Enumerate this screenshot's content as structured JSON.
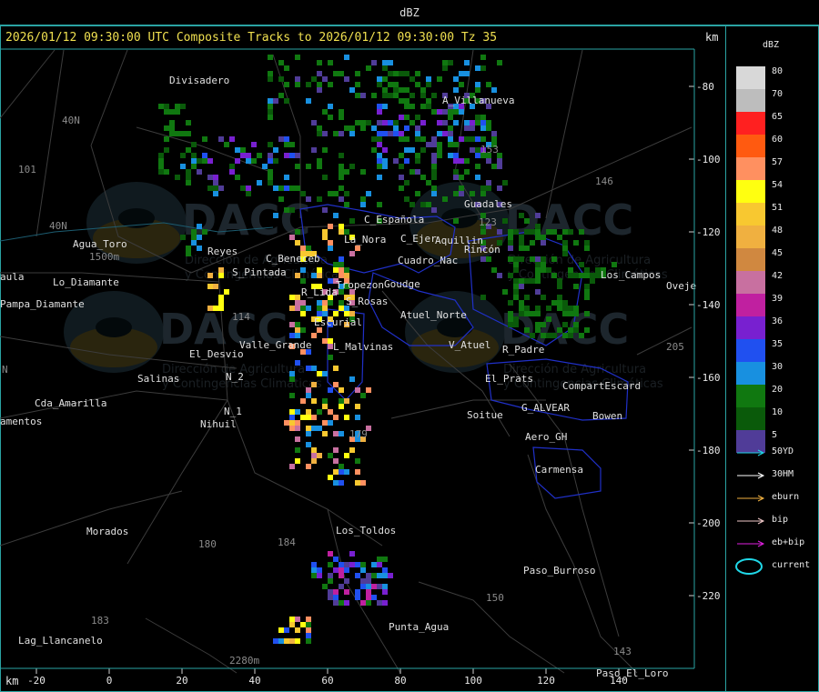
{
  "header": {
    "title": "dBZ"
  },
  "map": {
    "subtitle": "2026/01/12 09:30:00 UTC Composite Tracks to 2026/01/12 09:30:00 Tz 35",
    "unit_label": "km",
    "x_ticks": [
      "-20",
      "0",
      "20",
      "40",
      "60",
      "80",
      "100",
      "120",
      "140"
    ],
    "y_ticks": [
      "-80",
      "-100",
      "-120",
      "-140",
      "-160",
      "-180",
      "-200",
      "-220"
    ],
    "places": [
      {
        "name": "Divisadero"
      },
      {
        "name": "A_Villanueva"
      },
      {
        "name": "40N"
      },
      {
        "name": "101"
      },
      {
        "name": "40N"
      },
      {
        "name": "Agua_Toro"
      },
      {
        "name": "1500m"
      },
      {
        "name": "aula"
      },
      {
        "name": "Lo_Diamante"
      },
      {
        "name": "Pampa_Diamante"
      },
      {
        "name": "Reyes"
      },
      {
        "name": "S_Pintada"
      },
      {
        "name": "C_Beneceb"
      },
      {
        "name": "La_Nora"
      },
      {
        "name": "C_Española"
      },
      {
        "name": "C_Ejer"
      },
      {
        "name": "Cuadro_Nac"
      },
      {
        "name": "Aquillin"
      },
      {
        "name": "Rincón"
      },
      {
        "name": "Guadales"
      },
      {
        "name": "Tropezon"
      },
      {
        "name": "Goudge"
      },
      {
        "name": "R_Lida"
      },
      {
        "name": "S_Rosas"
      },
      {
        "name": "Atuel_Norte"
      },
      {
        "name": "Escurial"
      },
      {
        "name": "Valle_Grande"
      },
      {
        "name": "L_Malvinas"
      },
      {
        "name": "El_Desvio"
      },
      {
        "name": "V_Atuel"
      },
      {
        "name": "R_Padre"
      },
      {
        "name": "Salinas"
      },
      {
        "name": "N_2"
      },
      {
        "name": "El_Prats"
      },
      {
        "name": "CompartEscard"
      },
      {
        "name": "N_1"
      },
      {
        "name": "Cda_Amarilla"
      },
      {
        "name": "amentos"
      },
      {
        "name": "Nihuil"
      },
      {
        "name": "G_ALVEAR"
      },
      {
        "name": "Soitue"
      },
      {
        "name": "Bowen"
      },
      {
        "name": "Aero_GH"
      },
      {
        "name": "Carmensa"
      },
      {
        "name": "Morados"
      },
      {
        "name": "Los_Toldos"
      },
      {
        "name": "Paso_Burroso"
      },
      {
        "name": "Punta_Agua"
      },
      {
        "name": "Lag_Llancanelo"
      },
      {
        "name": "Paso_El_Loro"
      },
      {
        "name": "Los_Campos"
      },
      {
        "name": "Oveje"
      },
      {
        "name": "2280m"
      },
      {
        "name": "N"
      },
      {
        "name": "205"
      },
      {
        "name": "146"
      },
      {
        "name": "153"
      },
      {
        "name": "143"
      },
      {
        "name": "150"
      },
      {
        "name": "180"
      },
      {
        "name": "184"
      },
      {
        "name": "183"
      },
      {
        "name": "179"
      },
      {
        "name": "114"
      },
      {
        "name": "123"
      }
    ],
    "watermarks": [
      {
        "text": "DACC",
        "sub1": "Dirección de Agricultura",
        "sub2": "y Contingencias Climáticas"
      },
      {
        "text": "DACC",
        "sub1": "Dirección de Agricultura",
        "sub2": "y Contingencias Climáticas"
      },
      {
        "text": "DACC",
        "sub1": "Dirección de Agricultura",
        "sub2": "y Contingencias Climáticas"
      },
      {
        "text": "DACC",
        "sub1": "Dirección de Agricultura",
        "sub2": "y Contingencias Climáticas"
      }
    ]
  },
  "legend": {
    "title": "dBZ",
    "scale": [
      {
        "value": "80",
        "color": "#d8d8d8"
      },
      {
        "value": "70",
        "color": "#bdbdbd"
      },
      {
        "value": "65",
        "color": "#ff2020"
      },
      {
        "value": "60",
        "color": "#ff5a10"
      },
      {
        "value": "57",
        "color": "#ff9060"
      },
      {
        "value": "54",
        "color": "#ffff10"
      },
      {
        "value": "51",
        "color": "#f8c830"
      },
      {
        "value": "48",
        "color": "#f0b040"
      },
      {
        "value": "45",
        "color": "#d08840"
      },
      {
        "value": "42",
        "color": "#c870a0"
      },
      {
        "value": "39",
        "color": "#c020a0"
      },
      {
        "value": "36",
        "color": "#7820d0"
      },
      {
        "value": "35",
        "color": "#2050f0"
      },
      {
        "value": "30",
        "color": "#1890e0"
      },
      {
        "value": "20",
        "color": "#107810"
      },
      {
        "value": "10",
        "color": "#0a5a0a"
      },
      {
        "value": "5",
        "color": "#503c98"
      }
    ],
    "tracks": [
      {
        "label": "50YD",
        "color": "#20d8e8"
      },
      {
        "label": "30HM",
        "color": "#ffffff"
      },
      {
        "label": "eburn",
        "color": "#f0b040"
      },
      {
        "label": "bip",
        "color": "#f0c8c8"
      },
      {
        "label": "eb+bip",
        "color": "#e020e0"
      },
      {
        "label": "current",
        "color": "#20d8e8"
      }
    ]
  }
}
